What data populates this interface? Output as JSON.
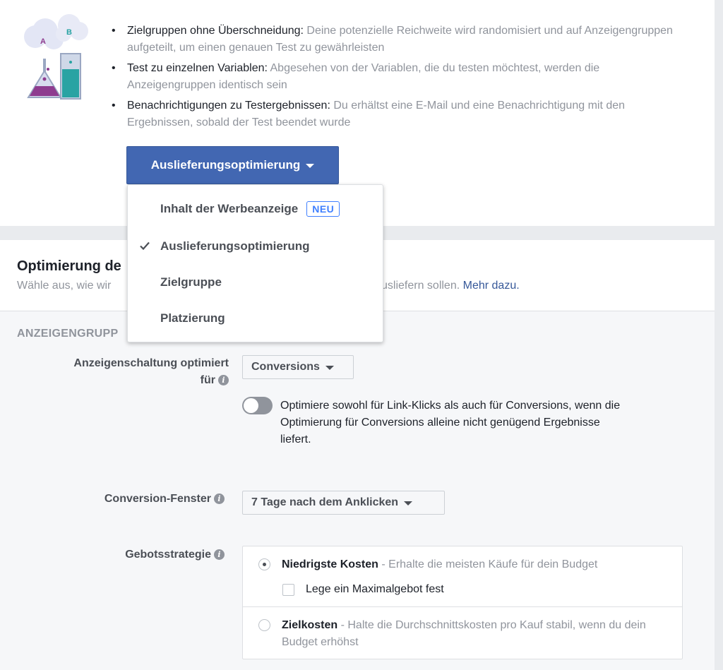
{
  "bullets": [
    {
      "term": "Zielgruppen ohne Überschneidung:",
      "desc": " Deine potenzielle Reichweite wird randomisiert und auf Anzeigengruppen aufgeteilt, um einen genauen Test zu gewährleisten"
    },
    {
      "term": "Test zu einzelnen Variablen:",
      "desc": " Abgesehen von der Variablen, die du testen möchtest, werden die Anzeigengruppen identisch sein"
    },
    {
      "term": "Benachrichtigungen zu Testergebnissen:",
      "desc": " Du erhältst eine E-Mail und eine Benachrichtigung mit den Ergebnissen, sobald der Test beendet wurde"
    }
  ],
  "illustration": {
    "label_a": "A",
    "label_b": "B"
  },
  "variable_dropdown": {
    "label": "Auslieferungsoptimierung",
    "menu": [
      {
        "label": "Inhalt der Werbeanzeige",
        "badge": "NEU",
        "checked": false
      },
      {
        "label": "Auslieferungsoptimierung",
        "checked": true
      },
      {
        "label": "Zielgruppe",
        "checked": false
      },
      {
        "label": "Platzierung",
        "checked": false
      }
    ]
  },
  "section": {
    "title_visible": "Optimierung de",
    "subtitle_left": "Wähle aus, wie wir",
    "subtitle_right": "usliefern sollen.",
    "link": "Mehr dazu.",
    "group_header_visible": "ANZEIGENGRUPP"
  },
  "fields": {
    "optimization": {
      "label_line1": "Anzeigenschaltung optimiert",
      "label_line2": "für",
      "value": "Conversions",
      "toggle_on": false,
      "toggle_text": "Optimiere sowohl für Link-Klicks als auch für Conversions, wenn die Optimierung für Conversions alleine nicht genügend Ergebnisse liefert."
    },
    "conversion_window": {
      "label": "Conversion-Fenster",
      "value": "7 Tage nach dem Anklicken"
    },
    "bid_strategy": {
      "label": "Gebotsstrategie",
      "options": [
        {
          "name": "Niedrigste Kosten",
          "desc": " - Erhalte die meisten Käufe für dein Budget",
          "selected": true
        },
        {
          "name": "Zielkosten",
          "desc": " - Halte die Durchschnittskosten pro Kauf stabil, wenn du dein Budget erhöhst",
          "selected": false
        }
      ],
      "checkbox_label": "Lege ein Maximalgebot fest",
      "checkbox_checked": false
    }
  },
  "colors": {
    "primary": "#4267b2",
    "link": "#365899",
    "badge": "#4080ff",
    "muted": "#90949c",
    "flask_purple": "#8e3c8f",
    "flask_teal": "#29a3a3"
  }
}
